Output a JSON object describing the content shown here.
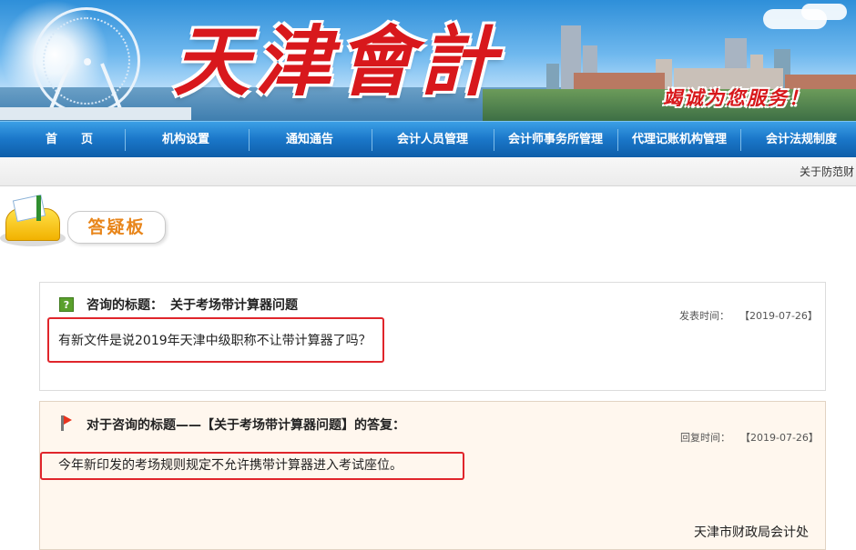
{
  "header": {
    "site_title": "天津會計",
    "slogan": "竭诚为您服务！"
  },
  "nav": {
    "items": [
      {
        "label": "首　　页"
      },
      {
        "label": "机构设置"
      },
      {
        "label": "通知通告"
      },
      {
        "label": "会计人员管理"
      },
      {
        "label": "会计师事务所管理"
      },
      {
        "label": "代理记账机构管理"
      },
      {
        "label": "会计法规制度"
      }
    ],
    "accent_color": "#1a76c8"
  },
  "marquee": {
    "text": "关于防范财"
  },
  "board": {
    "heading": "答疑板",
    "icon": "mailbox-icon"
  },
  "question": {
    "icon": "question-icon",
    "title_prefix": "咨询的标题：",
    "title": "关于考场带计算器问题",
    "date_label": "发表时间：",
    "date": "【2019-07-26】",
    "body": "有新文件是说2019年天津中级职称不让带计算器了吗？"
  },
  "answer": {
    "icon": "flag-icon",
    "title": "对于咨询的标题——【关于考场带计算器问题】的答复：",
    "date_label": "回复时间：",
    "date": "【2019-07-26】",
    "body": "今年新印发的考场规则规定不允许携带计算器进入考试座位。",
    "signature": "天津市财政局会计处"
  },
  "highlight_color": "#e0252b"
}
